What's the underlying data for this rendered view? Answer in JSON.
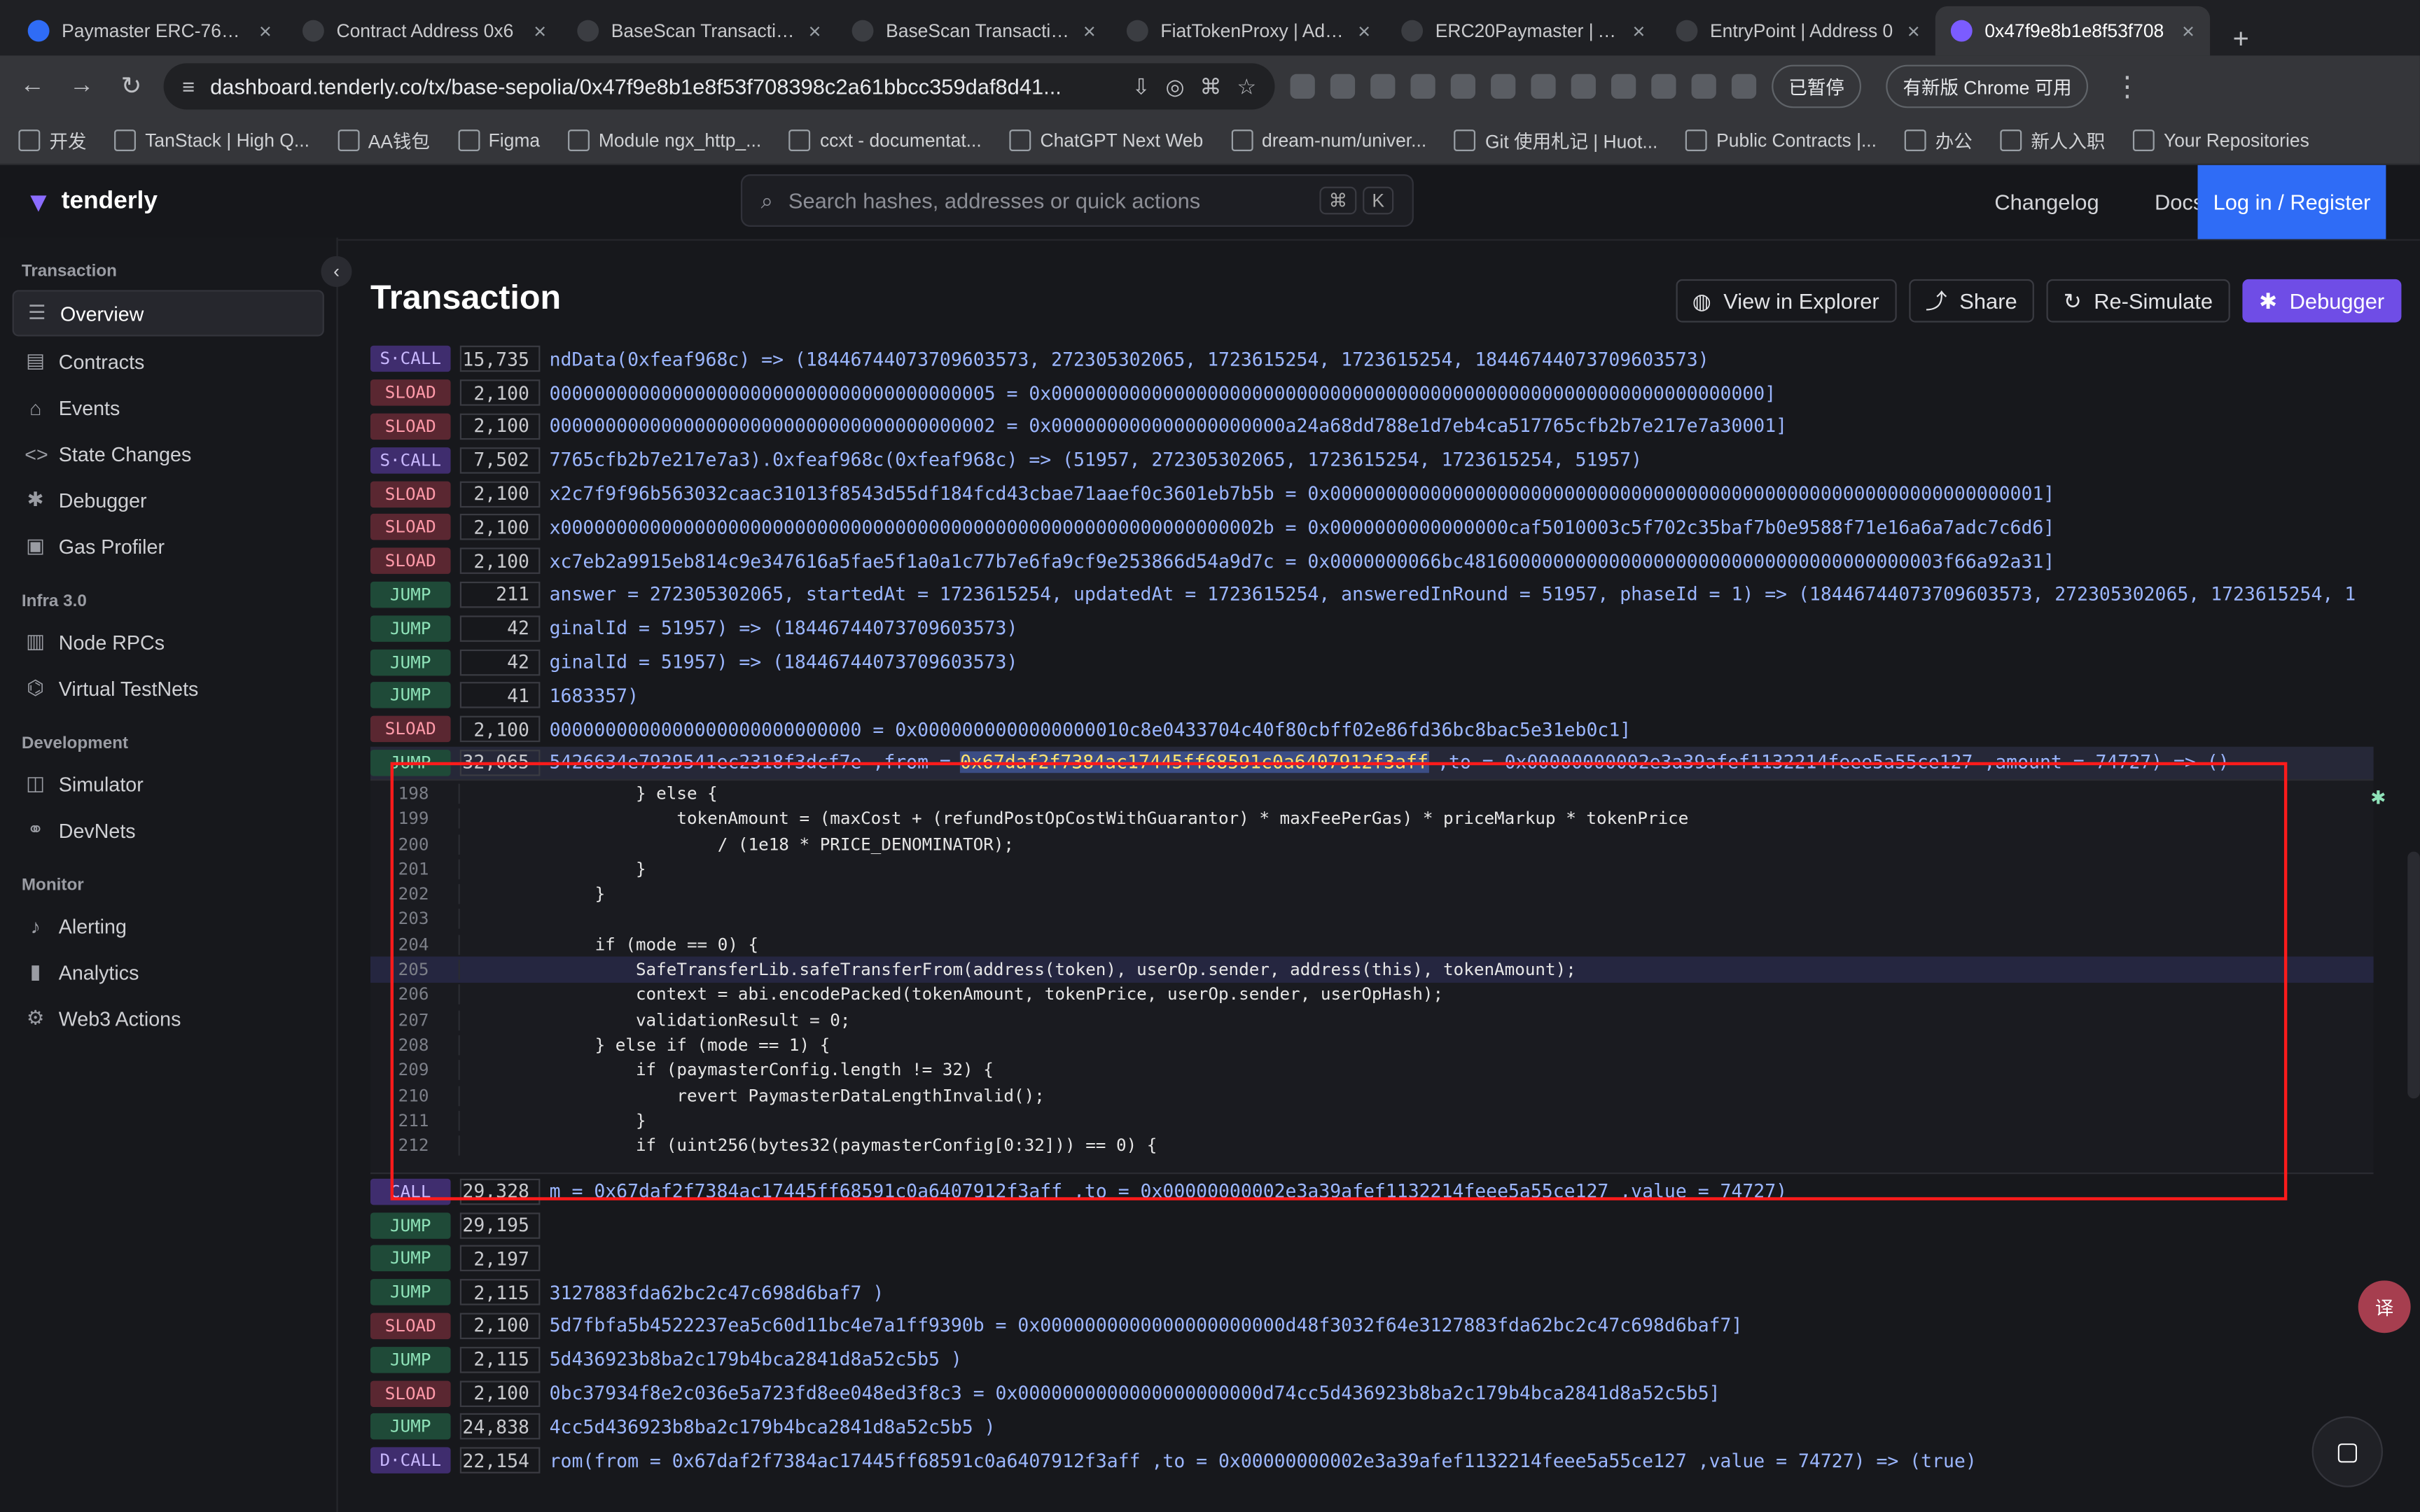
{
  "browser": {
    "tabs": [
      {
        "label": "Paymaster ERC-7677 -"
      },
      {
        "label": "Contract Address 0x6"
      },
      {
        "label": "BaseScan Transaction"
      },
      {
        "label": "BaseScan Transaction"
      },
      {
        "label": "FiatTokenProxy | Addre"
      },
      {
        "label": "ERC20Paymaster | Add"
      },
      {
        "label": "EntryPoint | Address 0"
      },
      {
        "label": "0x47f9e8b1e8f53f708"
      }
    ],
    "url": "dashboard.tenderly.co/tx/base-sepolia/0x47f9e8b1e8f53f708398c2a61bbcc359daf8d41...",
    "paused_label": "已暂停",
    "update_label": "有新版 Chrome 可用",
    "bookmarks": [
      "开发",
      "TanStack | High Q...",
      "AA钱包",
      "Figma",
      "Module ngx_http_...",
      "ccxt - documentat...",
      "ChatGPT Next Web",
      "dream-num/univer...",
      "Git 使用札记 | Huot...",
      "Public Contracts |...",
      "办公",
      "新人入职",
      "Your Repositories"
    ]
  },
  "app": {
    "logo": "tenderly",
    "search_placeholder": "Search hashes, addresses or quick actions",
    "kbd1": "⌘",
    "kbd2": "K",
    "changelog": "Changelog",
    "docs": "Docs",
    "login": "Log in / Register"
  },
  "sidebar": {
    "groups": [
      {
        "title": "Transaction",
        "items": [
          {
            "label": "Overview",
            "icon": "grid-icon"
          },
          {
            "label": "Contracts",
            "icon": "file-icon"
          },
          {
            "label": "Events",
            "icon": "bookmark-icon"
          },
          {
            "label": "State Changes",
            "icon": "code-icon"
          },
          {
            "label": "Debugger",
            "icon": "bug-icon"
          },
          {
            "label": "Gas Profiler",
            "icon": "chip-icon"
          }
        ]
      },
      {
        "title": "Infra 3.0",
        "items": [
          {
            "label": "Node RPCs",
            "icon": "server-icon"
          },
          {
            "label": "Virtual TestNets",
            "icon": "network-icon"
          }
        ]
      },
      {
        "title": "Development",
        "items": [
          {
            "label": "Simulator",
            "icon": "play-icon"
          },
          {
            "label": "DevNets",
            "icon": "nodes-icon"
          }
        ]
      },
      {
        "title": "Monitor",
        "items": [
          {
            "label": "Alerting",
            "icon": "bell-icon"
          },
          {
            "label": "Analytics",
            "icon": "chart-icon"
          },
          {
            "label": "Web3 Actions",
            "icon": "cog-icon"
          }
        ]
      }
    ]
  },
  "page": {
    "title": "Transaction",
    "actions": {
      "explorer": "View in Explorer",
      "share": "Share",
      "resim": "Re-Simulate",
      "debugger": "Debugger"
    }
  },
  "trace": {
    "top_rows": [
      {
        "op": "S·CALL",
        "opclass": "SCALL",
        "gas": "15,735",
        "text": "ndData(0xfeaf968c) => (18446744073709603573, 272305302065, 1723615254, 1723615254, 18446744073709603573)"
      },
      {
        "op": "SLOAD",
        "opclass": "SLOAD",
        "gas": "2,100",
        "text": "0000000000000000000000000000000000000005 = 0x0000000000000000000000000000000000000000000000000000000000000000]"
      },
      {
        "op": "SLOAD",
        "opclass": "SLOAD",
        "gas": "2,100",
        "text": "0000000000000000000000000000000000000002 = 0x000000000000000000000a24a68dd788e1d7eb4ca517765cfb2b7e217e7a30001]"
      },
      {
        "op": "S·CALL",
        "opclass": "SCALL",
        "gas": "7,502",
        "text": "7765cfb2b7e217e7a3).0xfeaf968c(0xfeaf968c) => (51957, 272305302065, 1723615254, 1723615254, 51957)"
      },
      {
        "op": "SLOAD",
        "opclass": "SLOAD",
        "gas": "2,100",
        "text": "x2c7f9f96b563032caac31013f8543d55df184fcd43cbae71aaef0c3601eb7b5b = 0x0000000000000000000000000000000000000000000000000000000000000001]"
      },
      {
        "op": "SLOAD",
        "opclass": "SLOAD",
        "gas": "2,100",
        "text": "x000000000000000000000000000000000000000000000000000000000000002b = 0x0000000000000000caf5010003c5f702c35baf7b0e9588f71e16a6a7adc7c6d6]"
      },
      {
        "op": "SLOAD",
        "opclass": "SLOAD",
        "gas": "2,100",
        "text": "xc7eb2a9915eb814c9e347616a5fae5f1a0a1c77b7e6fa9cf9e253866d54a9d7c = 0x0000000066bc4816000000000000000000000000000000000000003f66a92a31]"
      },
      {
        "op": "JUMP",
        "opclass": "JUMP",
        "gas": "211",
        "text": "answer = 272305302065, startedAt = 1723615254, updatedAt = 1723615254, answeredInRound = 51957, phaseId = 1) => (18446744073709603573, 272305302065, 1723615254, 1"
      },
      {
        "op": "JUMP",
        "opclass": "JUMP",
        "gas": "42",
        "text": "ginalId = 51957) => (18446744073709603573)"
      },
      {
        "op": "JUMP",
        "opclass": "JUMP",
        "gas": "42",
        "text": "ginalId = 51957) => (18446744073709603573)"
      },
      {
        "op": "JUMP",
        "opclass": "JUMP",
        "gas": "41",
        "text": "1683357)"
      },
      {
        "op": "SLOAD",
        "opclass": "SLOAD",
        "gas": "2,100",
        "text": "0000000000000000000000000000 = 0x0000000000000000010c8e0433704c40f80cbff02e86fd36bc8bac5e31eb0c1]"
      }
    ],
    "selected_row": {
      "op": "JUMP",
      "gas": "32,065",
      "prefix": "5426634e7929541ec2318f3dcf7e ,from = ",
      "from": "0x67daf2f7384ac17445ff68591c0a6407912f3aff",
      "suffix": " ,to = 0x00000000002e3a39afef1132214feee5a55ce127 ,amount = 74727) => ()"
    },
    "code": [
      {
        "ln": "198",
        "code": "                } else {"
      },
      {
        "ln": "199",
        "code": "                    tokenAmount = (maxCost + (refundPostOpCostWithGuarantor) * maxFeePerGas) * priceMarkup * tokenPrice"
      },
      {
        "ln": "200",
        "code": "                        / (1e18 * PRICE_DENOMINATOR);"
      },
      {
        "ln": "201",
        "code": "                }"
      },
      {
        "ln": "202",
        "code": "            }"
      },
      {
        "ln": "203",
        "code": ""
      },
      {
        "ln": "204",
        "code": "            if (mode == 0) {"
      },
      {
        "ln": "205",
        "code": "                SafeTransferLib.safeTransferFrom(address(token), userOp.sender, address(this), tokenAmount);"
      },
      {
        "ln": "206",
        "code": "                context = abi.encodePacked(tokenAmount, tokenPrice, userOp.sender, userOpHash);"
      },
      {
        "ln": "207",
        "code": "                validationResult = 0;"
      },
      {
        "ln": "208",
        "code": "            } else if (mode == 1) {"
      },
      {
        "ln": "209",
        "code": "                if (paymasterConfig.length != 32) {"
      },
      {
        "ln": "210",
        "code": "                    revert PaymasterDataLengthInvalid();"
      },
      {
        "ln": "211",
        "code": "                }"
      },
      {
        "ln": "212",
        "code": "                if (uint256(bytes32(paymasterConfig[0:32])) == 0) {"
      }
    ],
    "bottom_rows": [
      {
        "op": "CALL",
        "opclass": "CALL",
        "gas": "29,328",
        "text": "m = 0x67daf2f7384ac17445ff68591c0a6407912f3aff ,to = 0x00000000002e3a39afef1132214feee5a55ce127 ,value = 74727)"
      },
      {
        "op": "JUMP",
        "opclass": "JUMP",
        "gas": "29,195",
        "text": ""
      },
      {
        "op": "JUMP",
        "opclass": "JUMP",
        "gas": "2,197",
        "text": ""
      },
      {
        "op": "JUMP",
        "opclass": "JUMP",
        "gas": "2,115",
        "text": "3127883fda62bc2c47c698d6baf7 )"
      },
      {
        "op": "SLOAD",
        "opclass": "SLOAD",
        "gas": "2,100",
        "text": "5d7fbfa5b4522237ea5c60d11bc4e7a1ff9390b = 0x0000000000000000000000d48f3032f64e3127883fda62bc2c47c698d6baf7]"
      },
      {
        "op": "JUMP",
        "opclass": "JUMP",
        "gas": "2,115",
        "text": "5d436923b8ba2c179b4bca2841d8a52c5b5 )"
      },
      {
        "op": "SLOAD",
        "opclass": "SLOAD",
        "gas": "2,100",
        "text": "0bc37934f8e2c036e5a723fd8ee048ed3f8c3 = 0x0000000000000000000000d74cc5d436923b8ba2c179b4bca2841d8a52c5b5]"
      },
      {
        "op": "JUMP",
        "opclass": "JUMP",
        "gas": "24,838",
        "text": "4cc5d436923b8ba2c179b4bca2841d8a52c5b5 )"
      },
      {
        "op": "D·CALL",
        "opclass": "DCALL",
        "gas": "22,154",
        "text": "rom(from = 0x67daf2f7384ac17445ff68591c0a6407912f3aff ,to = 0x00000000002e3a39afef1132214feee5a55ce127 ,value = 74727) => (true)"
      }
    ]
  },
  "ui_misc": {
    "bubble": "译"
  }
}
